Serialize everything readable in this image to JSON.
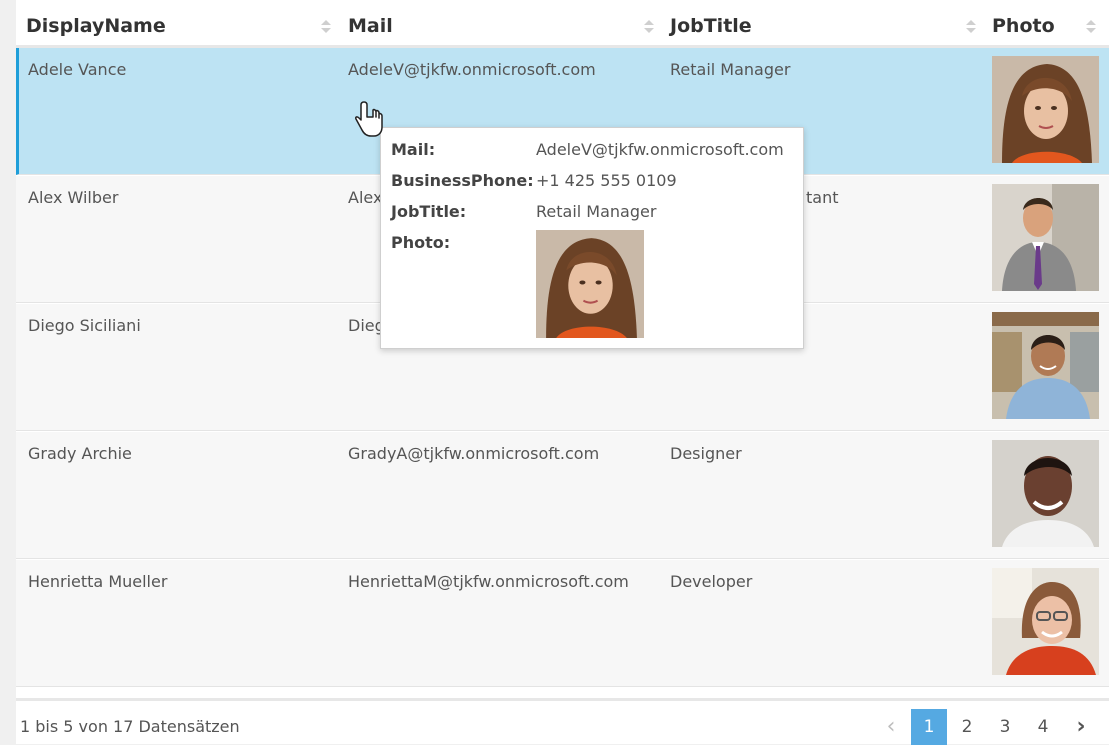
{
  "columns": [
    {
      "label": "DisplayName"
    },
    {
      "label": "Mail"
    },
    {
      "label": "JobTitle"
    },
    {
      "label": "Photo"
    }
  ],
  "rows": [
    {
      "display_name": "Adele Vance",
      "mail": "AdeleV@tjkfw.onmicrosoft.com",
      "job_title": "Retail Manager",
      "selected": true
    },
    {
      "display_name": "Alex Wilber",
      "mail": "Alex",
      "job_title": "tant",
      "selected": false
    },
    {
      "display_name": "Diego Siciliani",
      "mail": "Dieg",
      "job_title": "",
      "selected": false
    },
    {
      "display_name": "Grady Archie",
      "mail": "GradyA@tjkfw.onmicrosoft.com",
      "job_title": "Designer",
      "selected": false
    },
    {
      "display_name": "Henrietta Mueller",
      "mail": "HenriettaM@tjkfw.onmicrosoft.com",
      "job_title": "Developer",
      "selected": false
    }
  ],
  "tooltip": {
    "mail_label": "Mail:",
    "mail_value": "AdeleV@tjkfw.onmicrosoft.com",
    "phone_label": "BusinessPhone:",
    "phone_value": "+1 425 555 0109",
    "job_label": "JobTitle:",
    "job_value": "Retail Manager",
    "photo_label": "Photo:"
  },
  "footer": {
    "summary": "1 bis 5 von 17 Datensätzen",
    "prev_icon": "chevron-left-icon",
    "next_icon": "chevron-right-icon",
    "pages": [
      "1",
      "2",
      "3",
      "4"
    ],
    "active_page": "1"
  },
  "colors": {
    "selected_row": "#bde3f3",
    "selected_accent": "#1e9ed9",
    "active_page": "#55a9e2"
  }
}
